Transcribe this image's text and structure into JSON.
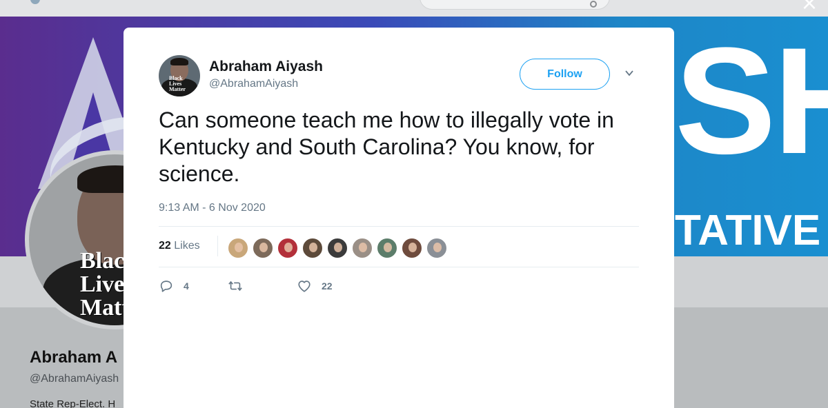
{
  "background_profile": {
    "name": "Abraham A",
    "handle": "@AbrahamAiyash",
    "bio": "State Rep-Elect. H",
    "banner_text": {
      "big": "SH",
      "small": "TATIVE"
    },
    "avatar_text": "Black\nLives\nMatter"
  },
  "close_icon": "×",
  "tweet": {
    "author": {
      "name": "Abraham Aiyash",
      "handle": "@AbrahamAiyash",
      "avatar_text": "Black Lives Matter"
    },
    "follow_label": "Follow",
    "text": "Can someone teach me how to illegally vote in Kentucky and South Carolina? You know, for science.",
    "timestamp": "9:13 AM - 6 Nov 2020",
    "likes": {
      "count": "22",
      "label": "Likes"
    },
    "likers": [
      {
        "name": "liker-1",
        "color": "#c9a77a"
      },
      {
        "name": "liker-2",
        "color": "#7d6a5a"
      },
      {
        "name": "liker-3",
        "color": "#b3303a"
      },
      {
        "name": "liker-4",
        "color": "#5d4a3a"
      },
      {
        "name": "liker-5",
        "color": "#3b3b3b"
      },
      {
        "name": "liker-6",
        "color": "#9a8f86"
      },
      {
        "name": "liker-7",
        "color": "#5c7d6a"
      },
      {
        "name": "liker-8",
        "color": "#6e4b3d"
      },
      {
        "name": "liker-9",
        "color": "#8a8f96"
      }
    ],
    "actions": {
      "reply_count": "4",
      "retweet_count": "",
      "like_count": "22"
    }
  },
  "colors": {
    "accent": "#1da1f2",
    "text_primary": "#14171a",
    "text_secondary": "#657786"
  }
}
